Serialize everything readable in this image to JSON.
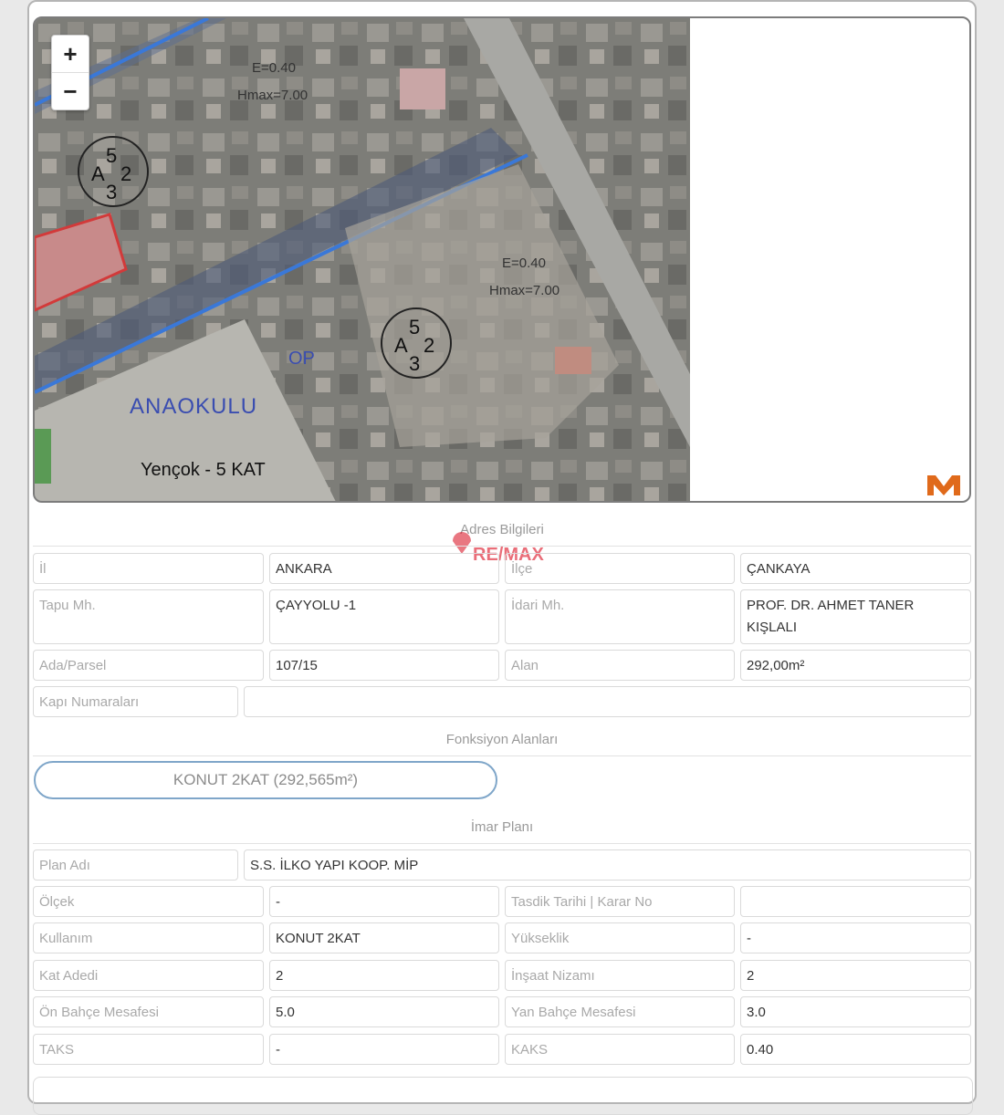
{
  "map": {
    "zoom_in_label": "+",
    "zoom_out_label": "−",
    "labels": {
      "e_top": "E=0.40",
      "hmax_top": "Hmax=7.00",
      "e_mid": "E=0.40",
      "hmax_mid": "Hmax=7.00",
      "zone_a_num": "A",
      "zone_top_num": "5",
      "zone_right_num": "2",
      "zone_bottom_num": "3",
      "op": "OP",
      "anaokulu": "ANAOKULU",
      "yencok": "Yençok - 5 KAT"
    }
  },
  "watermark": "RE/MAX",
  "address": {
    "title": "Adres Bilgileri",
    "il_label": "İl",
    "il_value": "ANKARA",
    "ilce_label": "İlçe",
    "ilce_value": "ÇANKAYA",
    "tapu_label": "Tapu Mh.",
    "tapu_value": "ÇAYYOLU -1",
    "idari_label": "İdari Mh.",
    "idari_value": "PROF. DR. AHMET TANER KIŞLALI",
    "ada_label": "Ada/Parsel",
    "ada_value": "107/15",
    "alan_label": "Alan",
    "alan_value": "292,00m²",
    "kapi_label": "Kapı Numaraları",
    "kapi_value": ""
  },
  "functions": {
    "title": "Fonksiyon Alanları",
    "item": "KONUT 2KAT (292,565m²)"
  },
  "plan": {
    "title": "İmar Planı",
    "plan_adi_label": "Plan Adı",
    "plan_adi_value": "S.S. İLKO YAPI KOOP. MİP",
    "olcek_label": "Ölçek",
    "olcek_value": "-",
    "tasdik_label": "Tasdik Tarihi | Karar No",
    "tasdik_value": "",
    "kullanim_label": "Kullanım",
    "kullanim_value": "KONUT 2KAT",
    "yukseklik_label": "Yükseklik",
    "yukseklik_value": "-",
    "kat_label": "Kat Adedi",
    "kat_value": "2",
    "nizam_label": "İnşaat Nizamı",
    "nizam_value": "2",
    "on_label": "Ön Bahçe Mesafesi",
    "on_value": "5.0",
    "yan_label": "Yan Bahçe Mesafesi",
    "yan_value": "3.0",
    "taks_label": "TAKS",
    "taks_value": "-",
    "kaks_label": "KAKS",
    "kaks_value": "0.40"
  },
  "colors": {
    "parcel_line": "#3a78d8",
    "parcel_red": "#d23a3a",
    "pill_border": "#7fa6c9",
    "remax_red": "#dc1c2e",
    "remax_blue": "#003da5"
  }
}
